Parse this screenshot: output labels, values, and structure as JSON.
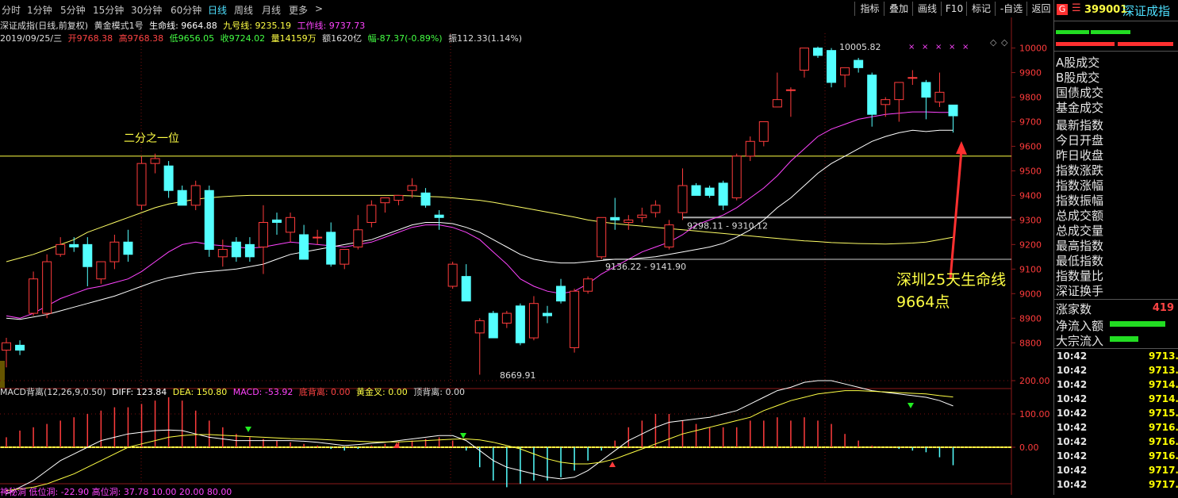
{
  "toolbar": {
    "tabs": [
      "分时",
      "1分钟",
      "5分钟",
      "15分钟",
      "30分钟",
      "60分钟",
      "日线",
      "周线",
      "月线",
      "更多"
    ],
    "active_tab": "日线",
    "more_arrow": ">",
    "tools": [
      "指标",
      "叠加",
      "画线",
      "F10",
      "标记",
      "-自选",
      "返回"
    ]
  },
  "info": {
    "title": "深证成指(日线,前复权)",
    "template": "黄金模式1号",
    "life_line": "生命线: 9664.88",
    "nine_line": "九号线: 9235.19",
    "work_line": "工作线: 9737.73",
    "date": "2019/09/25/三",
    "open": "开9768.38",
    "high": "高9768.38",
    "low": "低9656.05",
    "close": "收9724.02",
    "volume": "量14159万",
    "amount": "额1620亿",
    "change": "幅-87.37(-0.89%)",
    "amplitude": "振112.33(1.14%)",
    "macd_name": "MACD背离(12,26,9,0.50)",
    "diff": "DIFF: 123.84",
    "dea": "DEA: 150.80",
    "macd": "MACD: -53.92",
    "bottom_div": "底背离: 0.00",
    "golden": "黄金叉: 0.00",
    "top_div": "顶背离: 0.00",
    "bottom_line": "神秘洞  低位洞: -22.90  高位洞: 37.78  10.00  20.00  80.00"
  },
  "annotations": {
    "half": "二分之一位",
    "lifeline_title": "深圳25天生命线",
    "lifeline_value": "9664点",
    "high_label": "10005.82",
    "low_label": "8669.91",
    "range1": "9136.22 - 9141.90",
    "range2": "9298.11 - 9310.12"
  },
  "sidebar": {
    "code": "399001",
    "name": "深证成指",
    "labels": [
      "A股成交",
      "B股成交",
      "国债成交",
      "基金成交",
      "最新指数",
      "今日开盘",
      "昨日收盘",
      "指数涨跌",
      "指数涨幅",
      "指数振幅",
      "总成交额",
      "总成交量",
      "最高指数",
      "最低指数",
      "指数量比",
      "深证换手"
    ],
    "up_count_label": "涨家数",
    "up_count": "419",
    "net_inflow": "净流入额",
    "block_inflow": "大宗流入",
    "ticks": [
      {
        "time": "10:42",
        "price": "9713."
      },
      {
        "time": "10:42",
        "price": "9713."
      },
      {
        "time": "10:42",
        "price": "9714."
      },
      {
        "time": "10:42",
        "price": "9714."
      },
      {
        "time": "10:42",
        "price": "9715."
      },
      {
        "time": "10:42",
        "price": "9716."
      },
      {
        "time": "10:42",
        "price": "9716."
      },
      {
        "time": "10:42",
        "price": "9716."
      },
      {
        "time": "10:42",
        "price": "9717."
      },
      {
        "time": "10:42",
        "price": "9717."
      }
    ]
  },
  "chart_data": [
    {
      "type": "candlestick",
      "title": "深证成指 日线",
      "y_ticks": [
        8800,
        8900,
        9000,
        9100,
        9200,
        9300,
        9400,
        9500,
        9600,
        9700,
        9800,
        9900,
        10000
      ],
      "ylim": [
        8620,
        10060
      ],
      "colors": {
        "up": "#ff3c3c",
        "down": "#54ffff",
        "ma_life": "#ffffff",
        "ma_work": "#ff44ff",
        "ma_long": "#ffff66"
      },
      "candles": [
        {
          "o": 8770,
          "h": 8820,
          "l": 8700,
          "c": 8800
        },
        {
          "o": 8790,
          "h": 8810,
          "l": 8750,
          "c": 8770
        },
        {
          "o": 8920,
          "h": 9090,
          "l": 8910,
          "c": 9060
        },
        {
          "o": 8920,
          "h": 9160,
          "l": 8900,
          "c": 9130
        },
        {
          "o": 9160,
          "h": 9230,
          "l": 9150,
          "c": 9200
        },
        {
          "o": 9200,
          "h": 9230,
          "l": 9170,
          "c": 9190
        },
        {
          "o": 9200,
          "h": 9230,
          "l": 9030,
          "c": 9110
        },
        {
          "o": 9060,
          "h": 9130,
          "l": 9040,
          "c": 9130
        },
        {
          "o": 9130,
          "h": 9240,
          "l": 9100,
          "c": 9210
        },
        {
          "o": 9210,
          "h": 9260,
          "l": 9130,
          "c": 9160
        },
        {
          "o": 9360,
          "h": 9560,
          "l": 9340,
          "c": 9530
        },
        {
          "o": 9530,
          "h": 9570,
          "l": 9490,
          "c": 9550
        },
        {
          "o": 9520,
          "h": 9540,
          "l": 9390,
          "c": 9420
        },
        {
          "o": 9420,
          "h": 9440,
          "l": 9360,
          "c": 9360
        },
        {
          "o": 9360,
          "h": 9460,
          "l": 9340,
          "c": 9440
        },
        {
          "o": 9420,
          "h": 9440,
          "l": 9150,
          "c": 9180
        },
        {
          "o": 9150,
          "h": 9220,
          "l": 9110,
          "c": 9180
        },
        {
          "o": 9210,
          "h": 9230,
          "l": 9130,
          "c": 9150
        },
        {
          "o": 9200,
          "h": 9230,
          "l": 9130,
          "c": 9150
        },
        {
          "o": 9190,
          "h": 9360,
          "l": 9080,
          "c": 9290
        },
        {
          "o": 9300,
          "h": 9330,
          "l": 9240,
          "c": 9290
        },
        {
          "o": 9250,
          "h": 9330,
          "l": 9210,
          "c": 9310
        },
        {
          "o": 9240,
          "h": 9280,
          "l": 9140,
          "c": 9140
        },
        {
          "o": 9230,
          "h": 9260,
          "l": 9200,
          "c": 9230
        },
        {
          "o": 9250,
          "h": 9290,
          "l": 9110,
          "c": 9120
        },
        {
          "o": 9120,
          "h": 9180,
          "l": 9100,
          "c": 9180
        },
        {
          "o": 9190,
          "h": 9320,
          "l": 9180,
          "c": 9260
        },
        {
          "o": 9290,
          "h": 9380,
          "l": 9270,
          "c": 9360
        },
        {
          "o": 9370,
          "h": 9390,
          "l": 9330,
          "c": 9390
        },
        {
          "o": 9380,
          "h": 9400,
          "l": 9360,
          "c": 9400
        },
        {
          "o": 9420,
          "h": 9470,
          "l": 9390,
          "c": 9440
        },
        {
          "o": 9410,
          "h": 9430,
          "l": 9350,
          "c": 9360
        },
        {
          "o": 9320,
          "h": 9340,
          "l": 9260,
          "c": 9310
        },
        {
          "o": 9030,
          "h": 9130,
          "l": 9020,
          "c": 9120
        },
        {
          "o": 9070,
          "h": 9120,
          "l": 9030,
          "c": 8970
        },
        {
          "o": 8840,
          "h": 8900,
          "l": 8670,
          "c": 8890
        },
        {
          "o": 8920,
          "h": 8930,
          "l": 8820,
          "c": 8820
        },
        {
          "o": 8880,
          "h": 8930,
          "l": 8860,
          "c": 8920
        },
        {
          "o": 8950,
          "h": 8960,
          "l": 8790,
          "c": 8800
        },
        {
          "o": 8820,
          "h": 8990,
          "l": 8810,
          "c": 8960
        },
        {
          "o": 8920,
          "h": 8950,
          "l": 8880,
          "c": 8910
        },
        {
          "o": 9030,
          "h": 9060,
          "l": 8960,
          "c": 8970
        },
        {
          "o": 8780,
          "h": 9020,
          "l": 8760,
          "c": 9010
        },
        {
          "o": 9010,
          "h": 9070,
          "l": 9000,
          "c": 9060
        },
        {
          "o": 9150,
          "h": 9310,
          "l": 9140,
          "c": 9310
        },
        {
          "o": 9310,
          "h": 9390,
          "l": 9260,
          "c": 9300
        },
        {
          "o": 9290,
          "h": 9320,
          "l": 9260,
          "c": 9300
        },
        {
          "o": 9310,
          "h": 9350,
          "l": 9290,
          "c": 9320
        },
        {
          "o": 9330,
          "h": 9380,
          "l": 9310,
          "c": 9360
        },
        {
          "o": 9190,
          "h": 9300,
          "l": 9180,
          "c": 9280
        },
        {
          "o": 9330,
          "h": 9510,
          "l": 9300,
          "c": 9440
        },
        {
          "o": 9440,
          "h": 9450,
          "l": 9410,
          "c": 9400
        },
        {
          "o": 9430,
          "h": 9440,
          "l": 9390,
          "c": 9400
        },
        {
          "o": 9450,
          "h": 9460,
          "l": 9340,
          "c": 9360
        },
        {
          "o": 9390,
          "h": 9570,
          "l": 9380,
          "c": 9560
        },
        {
          "o": 9560,
          "h": 9640,
          "l": 9540,
          "c": 9620
        },
        {
          "o": 9620,
          "h": 9700,
          "l": 9600,
          "c": 9700
        },
        {
          "o": 9760,
          "h": 9900,
          "l": 9760,
          "c": 9790
        },
        {
          "o": 9830,
          "h": 9840,
          "l": 9720,
          "c": 9830
        },
        {
          "o": 9910,
          "h": 10000,
          "l": 9880,
          "c": 10000
        },
        {
          "o": 10000,
          "h": 10006,
          "l": 9960,
          "c": 9970
        },
        {
          "o": 9990,
          "h": 10000,
          "l": 9840,
          "c": 9860
        },
        {
          "o": 9890,
          "h": 9920,
          "l": 9840,
          "c": 9920
        },
        {
          "o": 9950,
          "h": 9960,
          "l": 9900,
          "c": 9920
        },
        {
          "o": 9890,
          "h": 9900,
          "l": 9680,
          "c": 9730
        },
        {
          "o": 9770,
          "h": 9800,
          "l": 9720,
          "c": 9790
        },
        {
          "o": 9790,
          "h": 9860,
          "l": 9700,
          "c": 9860
        },
        {
          "o": 9880,
          "h": 9910,
          "l": 9850,
          "c": 9880
        },
        {
          "o": 9860,
          "h": 9870,
          "l": 9710,
          "c": 9800
        },
        {
          "o": 9780,
          "h": 9900,
          "l": 9760,
          "c": 9820
        },
        {
          "o": 9768,
          "h": 9768,
          "l": 9656,
          "c": 9724
        }
      ],
      "ma_life": [
        8900,
        8895,
        8905,
        8915,
        8930,
        8945,
        8960,
        8975,
        8990,
        9010,
        9030,
        9050,
        9065,
        9075,
        9085,
        9090,
        9095,
        9100,
        9110,
        9120,
        9140,
        9160,
        9170,
        9180,
        9190,
        9200,
        9210,
        9220,
        9240,
        9260,
        9280,
        9290,
        9290,
        9285,
        9270,
        9250,
        9220,
        9190,
        9160,
        9140,
        9130,
        9125,
        9125,
        9130,
        9135,
        9140,
        9140,
        9145,
        9150,
        9160,
        9170,
        9180,
        9190,
        9205,
        9230,
        9260,
        9300,
        9350,
        9390,
        9440,
        9490,
        9530,
        9560,
        9590,
        9620,
        9640,
        9655,
        9665,
        9660,
        9665,
        9665
      ],
      "ma_work": [
        8910,
        8900,
        8920,
        8950,
        8980,
        9000,
        9020,
        9030,
        9045,
        9060,
        9090,
        9130,
        9170,
        9200,
        9210,
        9200,
        9195,
        9190,
        9185,
        9190,
        9200,
        9210,
        9205,
        9200,
        9195,
        9190,
        9200,
        9210,
        9230,
        9250,
        9270,
        9280,
        9280,
        9270,
        9250,
        9220,
        9170,
        9120,
        9060,
        9030,
        9010,
        9000,
        9010,
        9040,
        9080,
        9110,
        9140,
        9170,
        9190,
        9210,
        9240,
        9280,
        9300,
        9320,
        9350,
        9390,
        9430,
        9480,
        9540,
        9590,
        9640,
        9670,
        9690,
        9710,
        9720,
        9730,
        9735,
        9740,
        9740,
        9738,
        9738
      ],
      "ma_long": [
        9130,
        9145,
        9160,
        9180,
        9200,
        9220,
        9250,
        9270,
        9290,
        9310,
        9330,
        9350,
        9365,
        9375,
        9385,
        9390,
        9395,
        9398,
        9400,
        9400,
        9400,
        9400,
        9400,
        9400,
        9400,
        9400,
        9400,
        9400,
        9400,
        9400,
        9398,
        9396,
        9394,
        9390,
        9385,
        9380,
        9372,
        9362,
        9352,
        9342,
        9332,
        9322,
        9312,
        9300,
        9292,
        9285,
        9280,
        9275,
        9270,
        9265,
        9260,
        9255,
        9250,
        9245,
        9240,
        9235,
        9230,
        9225,
        9220,
        9215,
        9212,
        9208,
        9206,
        9204,
        9203,
        9202,
        9204,
        9206,
        9210,
        9220,
        9230
      ],
      "hlines": [
        9560,
        9310,
        9140
      ]
    },
    {
      "type": "bar",
      "title": "MACD背离(12,26,9,0.50)",
      "y_ticks": [
        0,
        100,
        200
      ],
      "ylim": [
        -100,
        220
      ],
      "diff": [
        -140,
        -120,
        -100,
        -70,
        -40,
        -20,
        0,
        20,
        30,
        40,
        45,
        50,
        52,
        50,
        40,
        30,
        25,
        20,
        20,
        20,
        20,
        20,
        18,
        15,
        10,
        5,
        8,
        12,
        15,
        20,
        25,
        30,
        35,
        35,
        20,
        -10,
        -40,
        -60,
        -70,
        -80,
        -90,
        -95,
        -90,
        -70,
        -40,
        -10,
        20,
        40,
        60,
        75,
        80,
        85,
        90,
        100,
        110,
        130,
        150,
        170,
        180,
        195,
        200,
        200,
        190,
        180,
        170,
        165,
        160,
        155,
        150,
        140,
        124
      ],
      "dea": [
        -130,
        -125,
        -120,
        -110,
        -95,
        -80,
        -60,
        -40,
        -20,
        0,
        10,
        20,
        30,
        35,
        38,
        38,
        36,
        34,
        32,
        30,
        28,
        26,
        25,
        24,
        22,
        20,
        18,
        16,
        16,
        16,
        18,
        20,
        22,
        24,
        25,
        22,
        15,
        5,
        -5,
        -20,
        -35,
        -45,
        -50,
        -50,
        -45,
        -35,
        -20,
        -5,
        10,
        25,
        40,
        50,
        60,
        70,
        80,
        90,
        110,
        125,
        140,
        150,
        160,
        165,
        170,
        170,
        168,
        166,
        164,
        162,
        160,
        155,
        151
      ],
      "macd": [
        30,
        50,
        60,
        70,
        80,
        90,
        100,
        110,
        120,
        120,
        130,
        140,
        150,
        140,
        110,
        80,
        60,
        40,
        30,
        25,
        20,
        15,
        10,
        5,
        -5,
        -10,
        -5,
        5,
        10,
        15,
        20,
        25,
        30,
        20,
        -10,
        -60,
        -100,
        -120,
        -110,
        -100,
        -100,
        -90,
        -70,
        -40,
        -10,
        20,
        60,
        80,
        100,
        100,
        80,
        70,
        60,
        60,
        60,
        80,
        80,
        90,
        80,
        90,
        80,
        70,
        40,
        20,
        5,
        0,
        -5,
        -10,
        -15,
        -30,
        -54
      ]
    }
  ]
}
